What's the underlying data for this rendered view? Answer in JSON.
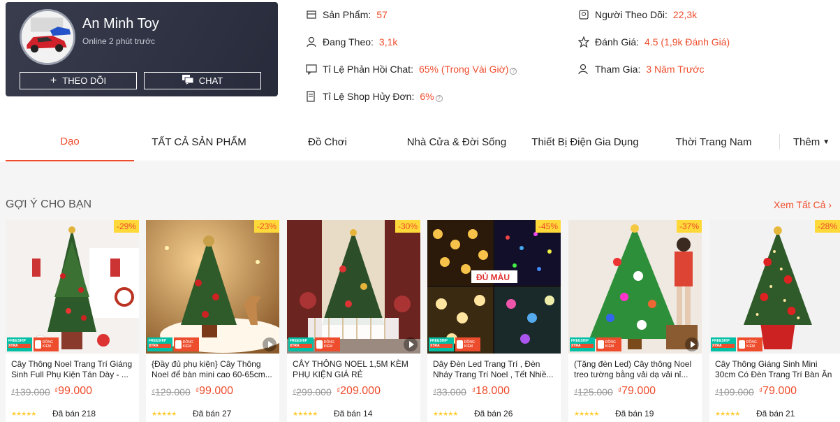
{
  "shop": {
    "name": "An Minh Toy",
    "status": "Online 2 phút trước",
    "follow_label": "THEO DÕI",
    "chat_label": "CHAT"
  },
  "stats": {
    "products_label": "Sản Phẩm:",
    "products_value": "57",
    "following_label": "Đang Theo:",
    "following_value": "3,1k",
    "chat_response_label": "Tỉ Lệ Phản Hồi Chat:",
    "chat_response_value": "65% (Trong Vài Giờ)",
    "cancel_rate_label": "Tỉ Lệ Shop Hủy Đơn:",
    "cancel_rate_value": "6%",
    "followers_label": "Người Theo Dõi:",
    "followers_value": "22,3k",
    "rating_label": "Đánh Giá:",
    "rating_value": "4.5 (1,9k Đánh Giá)",
    "joined_label": "Tham Gia:",
    "joined_value": "3 Năm Trước"
  },
  "tabs": [
    "Dạo",
    "TẤT CẢ SẢN PHẨM",
    "Đồ Chơi",
    "Nhà Cửa & Đời Sống",
    "Thiết Bị Điện Gia Dụng",
    "Thời Trang Nam",
    "Thêm"
  ],
  "section": {
    "title": "GỢI Ý CHO BẠN",
    "see_all": "Xem Tất Cả"
  },
  "badges": {
    "freeship": "FREESHIP",
    "xtra": "XTRA",
    "dong_kiem": "ĐỒNG KIỂM"
  },
  "products": [
    {
      "discount": "-29%",
      "name": "Cây Thông Noel Trang Trí Giáng Sinh Full Phụ Kiện Tán Dày - ...",
      "old_price": "139.000",
      "price": "99.000",
      "sold": "Đã bán 218"
    },
    {
      "discount": "-23%",
      "name": "{Đầy đủ phụ kiện} Cây Thông Noel để bàn mini cao 60-65cm...",
      "old_price": "129.000",
      "price": "99.000",
      "sold": "Đã bán 27"
    },
    {
      "discount": "-30%",
      "name": "CÂY THÔNG NOEL 1,5M KÈM PHỤ KIỆN GIÁ RẺ",
      "old_price": "299.000",
      "price": "209.000",
      "sold": "Đã bán 14"
    },
    {
      "discount": "-45%",
      "name": "Dây Đèn Led Trang Trí , Đèn Nháy Trang Trí Noel , Tết Nhiề...",
      "old_price": "33.000",
      "price": "18.000",
      "sold": "Đã bán 26",
      "image_text": "ĐỦ MÀU"
    },
    {
      "discount": "-37%",
      "name": "(Tặng đèn Led) Cây thông Noel treo tường bằng vải dạ vải nỉ...",
      "old_price": "125.000",
      "price": "79.000",
      "sold": "Đã bán 19"
    },
    {
      "discount": "-28%",
      "name": "Cây Thông Giáng Sinh Mini 30cm Có Đèn Trang Trí Bàn Ăn",
      "old_price": "109.000",
      "price": "79.000",
      "sold": "Đã bán 21"
    }
  ],
  "currency": "₫",
  "stars": "★★★★★",
  "colors": {
    "accent": "#ee4d2d",
    "shop_bg": "#2e3244",
    "page_bg": "#f5f5f5"
  }
}
